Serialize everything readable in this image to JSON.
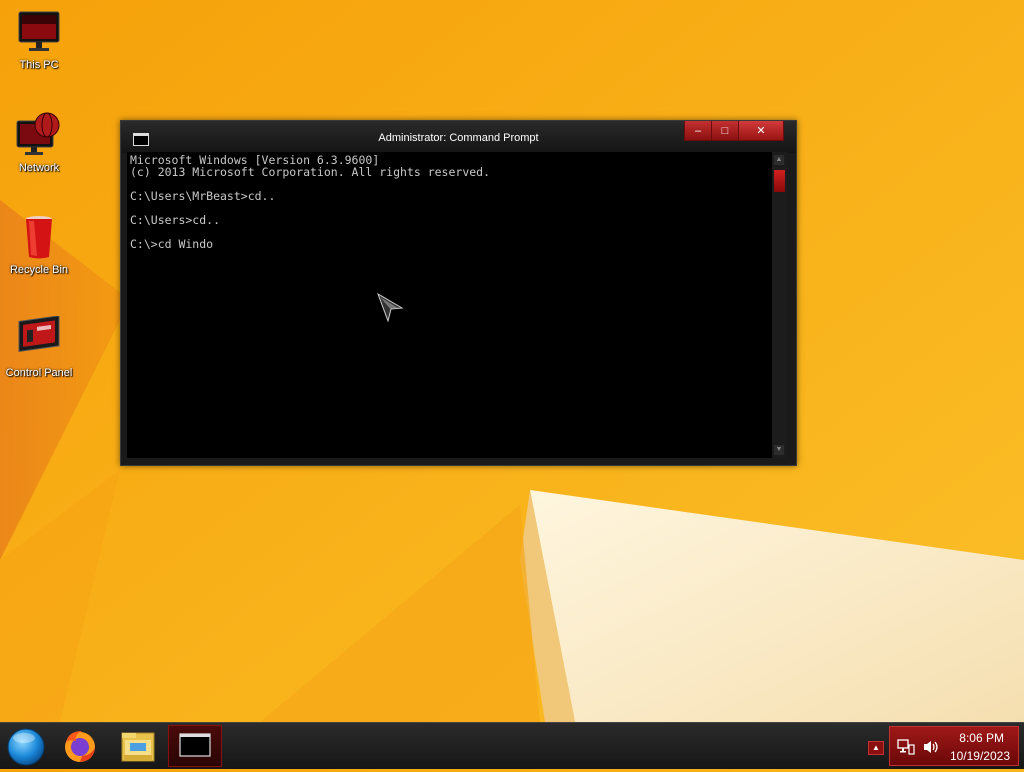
{
  "desktop": {
    "icons": [
      {
        "label": "This PC",
        "icon": "monitor-icon"
      },
      {
        "label": "Network",
        "icon": "network-icon"
      },
      {
        "label": "Recycle Bin",
        "icon": "recycle-bin-icon"
      },
      {
        "label": "Control Panel",
        "icon": "control-panel-icon"
      }
    ]
  },
  "window": {
    "title": "Administrator: Command Prompt",
    "controls": {
      "minimize": "–",
      "maximize": "□",
      "close": "✕"
    },
    "console_lines": [
      "Microsoft Windows [Version 6.3.9600]",
      "(c) 2013 Microsoft Corporation. All rights reserved.",
      "",
      "C:\\Users\\MrBeast>cd..",
      "",
      "C:\\Users>cd..",
      "",
      "C:\\>cd Windo"
    ]
  },
  "taskbar": {
    "items": [
      {
        "name": "start-button",
        "icon": "start-orb-icon"
      },
      {
        "name": "firefox",
        "icon": "firefox-icon"
      },
      {
        "name": "file-explorer",
        "icon": "folder-icon"
      },
      {
        "name": "command-prompt",
        "icon": "cmd-icon",
        "active": true
      }
    ],
    "cmd_glyph": "C:\\_",
    "tray_arrow": "▲",
    "time": "8:06 PM",
    "date": "10/19/2023"
  },
  "colors": {
    "accent": "#b01414",
    "wallpaper": "#f9b21a",
    "console_bg": "#000000",
    "console_text": "#c8c8c8"
  }
}
